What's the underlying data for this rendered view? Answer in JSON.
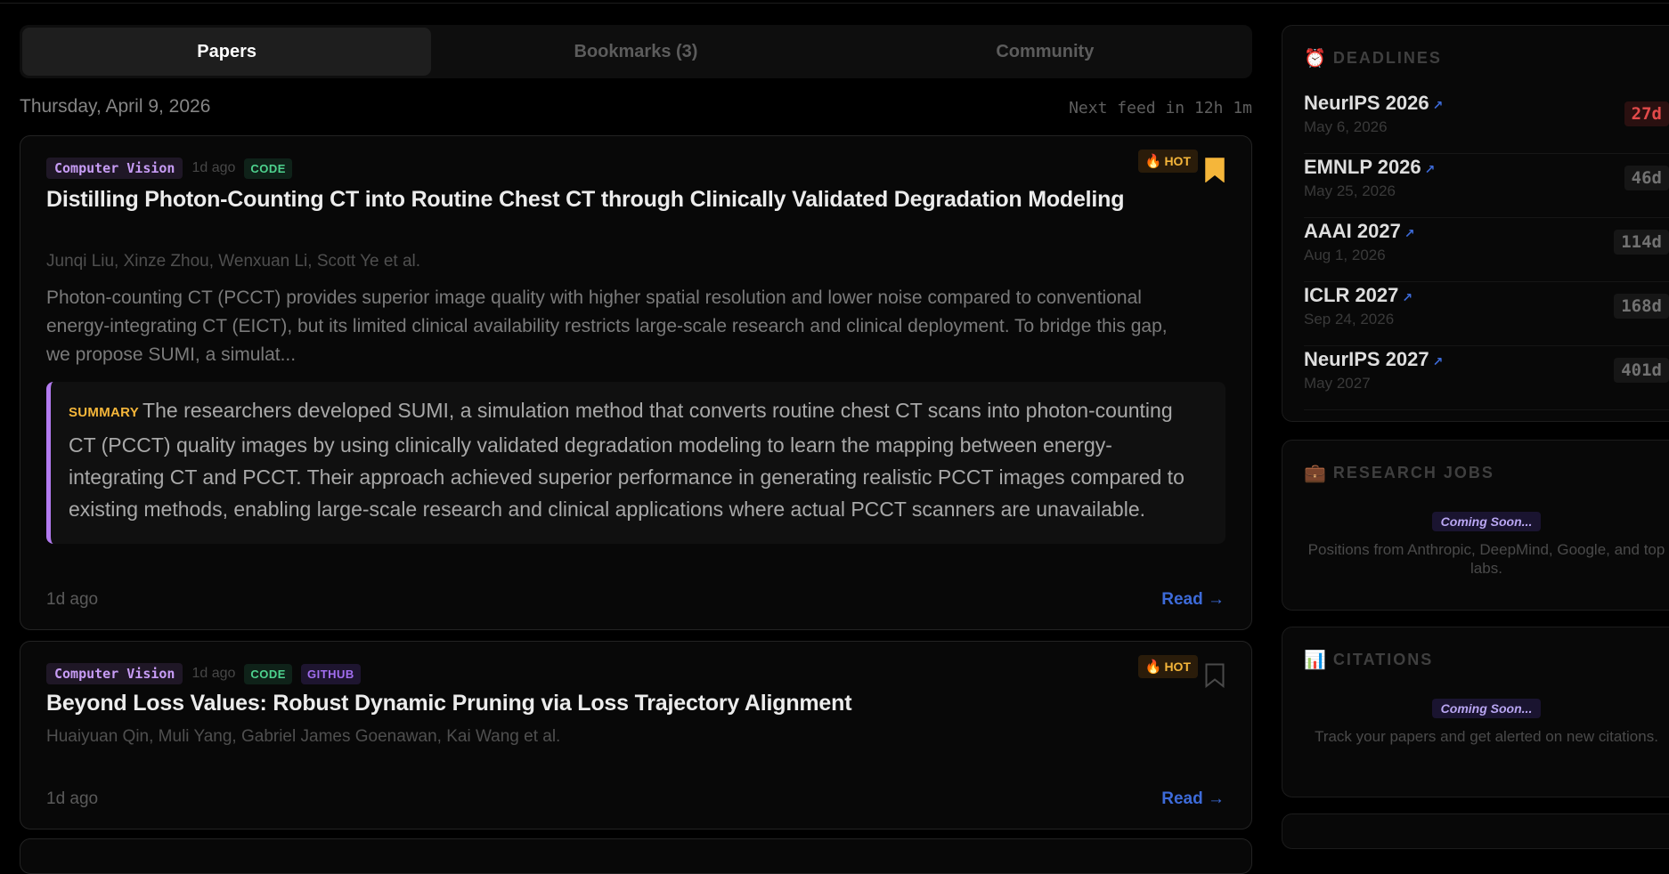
{
  "tabs": [
    {
      "label": "Papers",
      "active": true
    },
    {
      "label": "Bookmarks (3)",
      "active": false
    },
    {
      "label": "Community",
      "active": false
    }
  ],
  "date_text": "Thursday, April 9, 2026",
  "next_feed": "Next feed in 12h 1m",
  "papers": [
    {
      "category": "Computer Vision",
      "age_top": "1d ago",
      "badges": [
        "CODE"
      ],
      "hot_label": "HOT",
      "bookmarked": true,
      "title": "Distilling Photon-Counting CT into Routine Chest CT through Clinically Validated Degradation Modeling",
      "authors": "Junqi Liu, Xinze Zhou, Wenxuan Li, Scott Ye et al.",
      "abstract": "Photon-counting CT (PCCT) provides superior image quality with higher spatial resolution and lower noise compared to conventional energy-integrating CT (EICT), but its limited clinical availability restricts large-scale research and clinical deployment. To bridge this gap, we propose SUMI, a simulat...",
      "summary_label": "SUMMARY",
      "summary": "The researchers developed SUMI, a simulation method that converts routine chest CT scans into photon-counting CT (PCCT) quality images by using clinically validated degradation modeling to learn the mapping between energy-integrating CT and PCCT. Their approach achieved superior performance in generating realistic PCCT images compared to existing methods, enabling large-scale research and clinical applications where actual PCCT scanners are unavailable.",
      "age_bottom": "1d ago",
      "read_label": "Read →"
    },
    {
      "category": "Computer Vision",
      "age_top": "1d ago",
      "badges": [
        "CODE",
        "GITHUB"
      ],
      "hot_label": "HOT",
      "bookmarked": false,
      "title": "Beyond Loss Values: Robust Dynamic Pruning via Loss Trajectory Alignment",
      "authors": "Huaiyuan Qin, Muli Yang, Gabriel James Goenawan, Kai Wang et al.",
      "age_bottom": "1d ago",
      "read_label": "Read →"
    }
  ],
  "deadlines": {
    "heading": "DEADLINES",
    "icon": "alarm-clock-icon",
    "items": [
      {
        "name": "NeurIPS 2026",
        "date": "May 6, 2026",
        "days": "27d",
        "urgent": true
      },
      {
        "name": "EMNLP 2026",
        "date": "May 25, 2026",
        "days": "46d",
        "urgent": false
      },
      {
        "name": "AAAI 2027",
        "date": "Aug 1, 2026",
        "days": "114d",
        "urgent": false
      },
      {
        "name": "ICLR 2027",
        "date": "Sep 24, 2026",
        "days": "168d",
        "urgent": false
      },
      {
        "name": "NeurIPS 2027",
        "date": "May 2027",
        "days": "401d",
        "urgent": false
      }
    ]
  },
  "research_jobs": {
    "heading": "RESEARCH JOBS",
    "icon": "briefcase-icon",
    "badge": "Coming Soon...",
    "description": "Positions from Anthropic, DeepMind, Google, and top labs."
  },
  "citations": {
    "heading": "CITATIONS",
    "icon": "bar-chart-icon",
    "badge": "Coming Soon...",
    "description": "Track your papers and get alerted on new citations."
  },
  "colors": {
    "accent_purple": "#b37bf0",
    "hot_orange": "#f5b63a",
    "link_blue": "#3d6bd9",
    "urgent_red": "#e24a4a",
    "code_green": "#4ed28e"
  }
}
